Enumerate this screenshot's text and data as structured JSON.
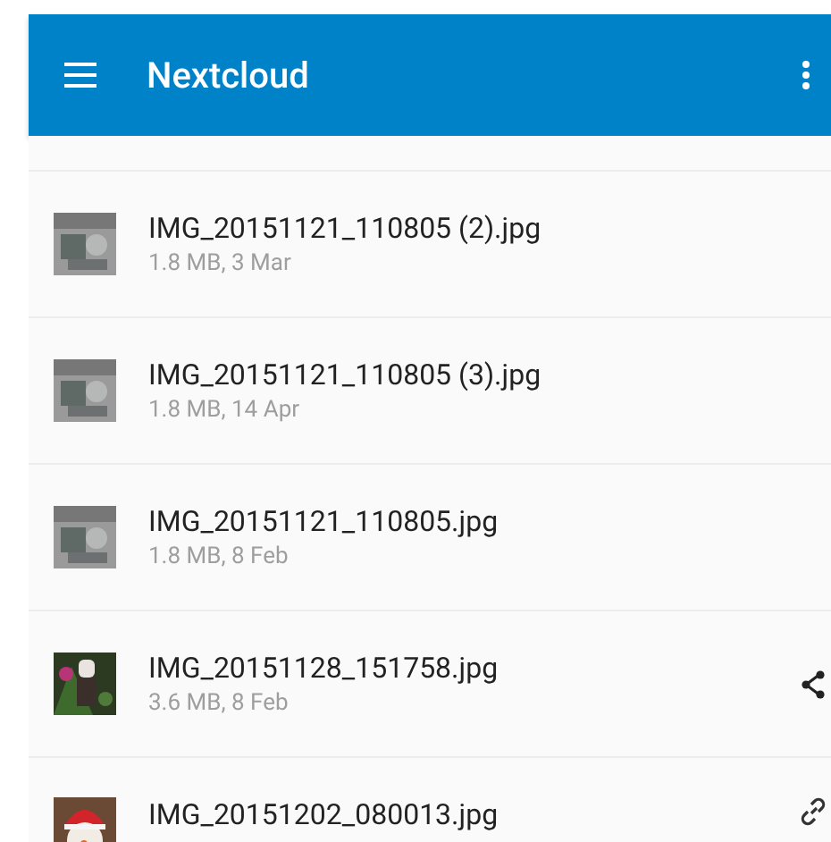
{
  "app_bar": {
    "title": "Nextcloud"
  },
  "files": [
    {
      "name": "IMG_20151121_110805 (2).jpg",
      "details": "1.8 MB, 3 Mar",
      "kind": "plain"
    },
    {
      "name": "IMG_20151121_110805 (3).jpg",
      "details": "1.8 MB, 14 Apr",
      "kind": "plain"
    },
    {
      "name": "IMG_20151121_110805.jpg",
      "details": "1.8 MB, 8 Feb",
      "kind": "plain"
    },
    {
      "name": "IMG_20151128_151758.jpg",
      "details": "3.6 MB, 8 Feb",
      "kind": "shared"
    },
    {
      "name": "IMG_20151202_080013.jpg",
      "kind": "linked"
    }
  ]
}
